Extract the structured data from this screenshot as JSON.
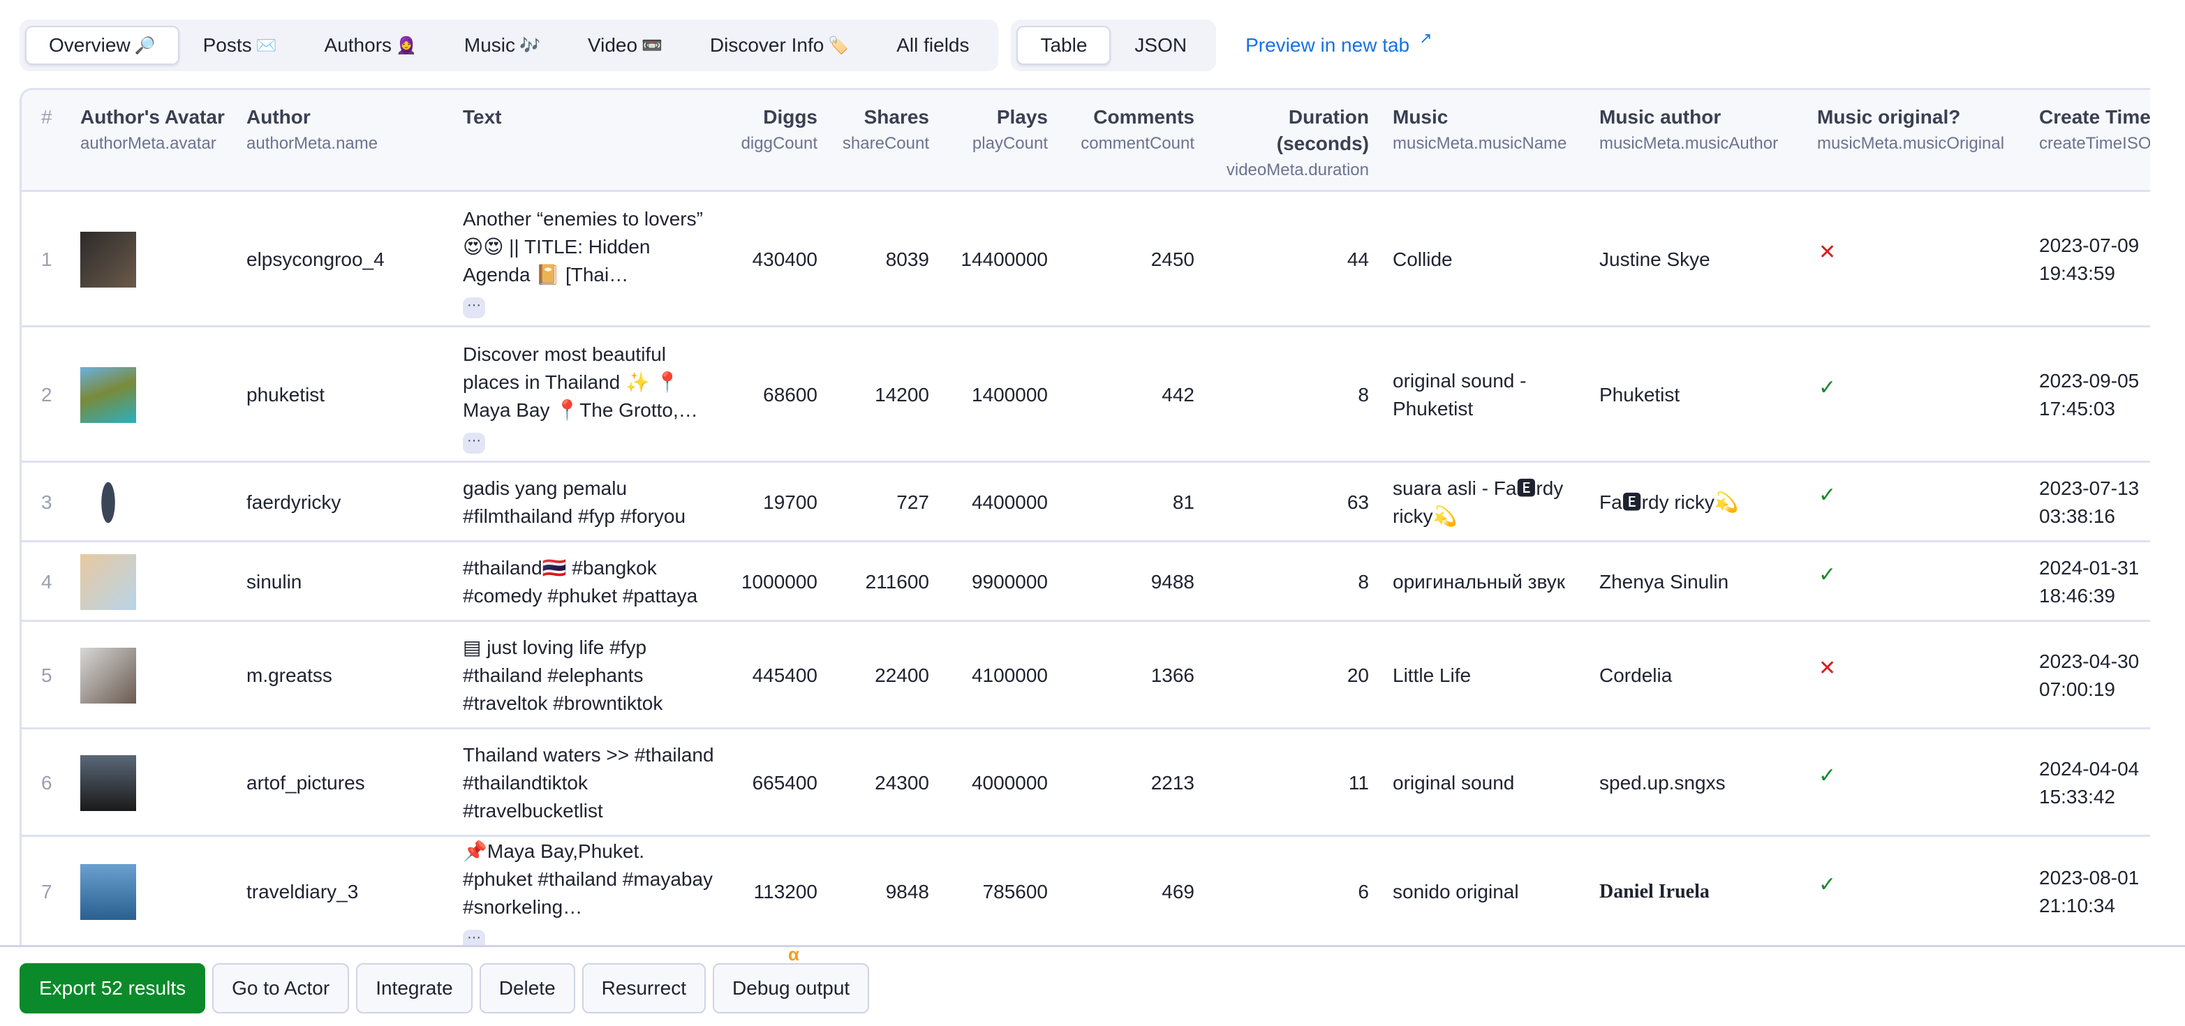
{
  "tabs": [
    {
      "label": "Overview",
      "emoji": "🔎",
      "active": true
    },
    {
      "label": "Posts",
      "emoji": "✉️",
      "active": false
    },
    {
      "label": "Authors",
      "emoji": "🧕",
      "active": false
    },
    {
      "label": "Music",
      "emoji": "🎶",
      "active": false
    },
    {
      "label": "Video",
      "emoji": "📼",
      "active": false
    },
    {
      "label": "Discover Info",
      "emoji": "🏷️",
      "active": false
    },
    {
      "label": "All fields",
      "emoji": "",
      "active": false
    }
  ],
  "view_tabs": [
    {
      "label": "Table",
      "active": true
    },
    {
      "label": "JSON",
      "active": false
    }
  ],
  "preview_link": {
    "label": "Preview in new tab",
    "icon": "↗"
  },
  "columns": [
    {
      "label": "#",
      "sub": ""
    },
    {
      "label": "Author's Avatar",
      "sub": "authorMeta.avatar"
    },
    {
      "label": "Author",
      "sub": "authorMeta.name"
    },
    {
      "label": "Text",
      "sub": ""
    },
    {
      "label": "Diggs",
      "sub": "diggCount"
    },
    {
      "label": "Shares",
      "sub": "shareCount"
    },
    {
      "label": "Plays",
      "sub": "playCount"
    },
    {
      "label": "Comments",
      "sub": "commentCount"
    },
    {
      "label": "Duration (seconds)",
      "sub": "videoMeta.duration"
    },
    {
      "label": "Music",
      "sub": "musicMeta.musicName"
    },
    {
      "label": "Music author",
      "sub": "musicMeta.musicAuthor"
    },
    {
      "label": "Music original?",
      "sub": "musicMeta.musicOriginal"
    },
    {
      "label": "Create Time",
      "sub": "createTimeISO"
    }
  ],
  "rows": [
    {
      "num": "1",
      "avatar": "avatar-image",
      "author": "elpsycongroo_4",
      "text": "Another “enemies to lovers” 😍😍 || TITLE: Hidden Agenda 📔 [Thai…",
      "truncated": true,
      "diggs": "430400",
      "shares": "8039",
      "plays": "14400000",
      "comments": "2450",
      "duration": "44",
      "music": "Collide",
      "music_author": "Justine Skye",
      "original": false,
      "create_date": "2023-07-09",
      "create_time": "19:43:59"
    },
    {
      "num": "2",
      "avatar": "avatar-image",
      "author": "phuketist",
      "text": "Discover most beautiful places in Thailand ✨ 📍Maya Bay 📍The Grotto,…",
      "truncated": true,
      "diggs": "68600",
      "shares": "14200",
      "plays": "1400000",
      "comments": "442",
      "duration": "8",
      "music": "original sound - Phuketist",
      "music_author": "Phuketist",
      "original": true,
      "create_date": "2023-09-05",
      "create_time": "17:45:03"
    },
    {
      "num": "3",
      "avatar": "avatar-image",
      "author": "faerdyricky",
      "text": "gadis yang pemalu #filmthailand #fyp #foryou",
      "truncated": false,
      "diggs": "19700",
      "shares": "727",
      "plays": "4400000",
      "comments": "81",
      "duration": "63",
      "music": "suara asli - Fa🅴rdy ricky💫",
      "music_author": "Fa🅴rdy ricky💫",
      "original": true,
      "create_date": "2023-07-13",
      "create_time": "03:38:16"
    },
    {
      "num": "4",
      "avatar": "avatar-image",
      "author": "sinulin",
      "text": "#thailand🇹🇭 #bangkok #comedy #phuket #pattaya",
      "truncated": false,
      "diggs": "1000000",
      "shares": "211600",
      "plays": "9900000",
      "comments": "9488",
      "duration": "8",
      "music": "оригинальный звук",
      "music_author": "Zhenya Sinulin",
      "original": true,
      "create_date": "2024-01-31",
      "create_time": "18:46:39"
    },
    {
      "num": "5",
      "avatar": "avatar-image",
      "author": "m.greatss",
      "text": "▤ just loving life #fyp #thailand #elephants #traveltok #browntiktok",
      "truncated": false,
      "diggs": "445400",
      "shares": "22400",
      "plays": "4100000",
      "comments": "1366",
      "duration": "20",
      "music": "Little Life",
      "music_author": "Cordelia",
      "original": false,
      "create_date": "2023-04-30",
      "create_time": "07:00:19"
    },
    {
      "num": "6",
      "avatar": "avatar-image",
      "author": "artof_pictures",
      "text": "Thailand waters >> #thailand #thailandtiktok #travelbucketlist",
      "truncated": false,
      "diggs": "665400",
      "shares": "24300",
      "plays": "4000000",
      "comments": "2213",
      "duration": "11",
      "music": "original sound",
      "music_author": "sped.up.sngxs",
      "original": true,
      "create_date": "2024-04-04",
      "create_time": "15:33:42"
    },
    {
      "num": "7",
      "avatar": "avatar-image",
      "author": "traveldiary_3",
      "text": "📌Maya Bay,Phuket. #phuket #thailand #mayabay #snorkeling…",
      "truncated": true,
      "diggs": "113200",
      "shares": "9848",
      "plays": "785600",
      "comments": "469",
      "duration": "6",
      "music": "sonido original",
      "music_author": "Daniel Iruela",
      "original": true,
      "create_date": "2023-08-01",
      "create_time": "21:10:34"
    }
  ],
  "bool_icons": {
    "true": "✓",
    "false": "✕"
  },
  "more_label": "···",
  "footer": {
    "export": "Export 52 results",
    "go_to_actor": "Go to Actor",
    "integrate": "Integrate",
    "delete": "Delete",
    "resurrect": "Resurrect",
    "debug_output": "Debug output",
    "debug_badge": "α"
  },
  "colors": {
    "accent": "#1672e6",
    "primary_button": "#0a8a2a",
    "true": "#1a8a2e",
    "false": "#d62020"
  }
}
